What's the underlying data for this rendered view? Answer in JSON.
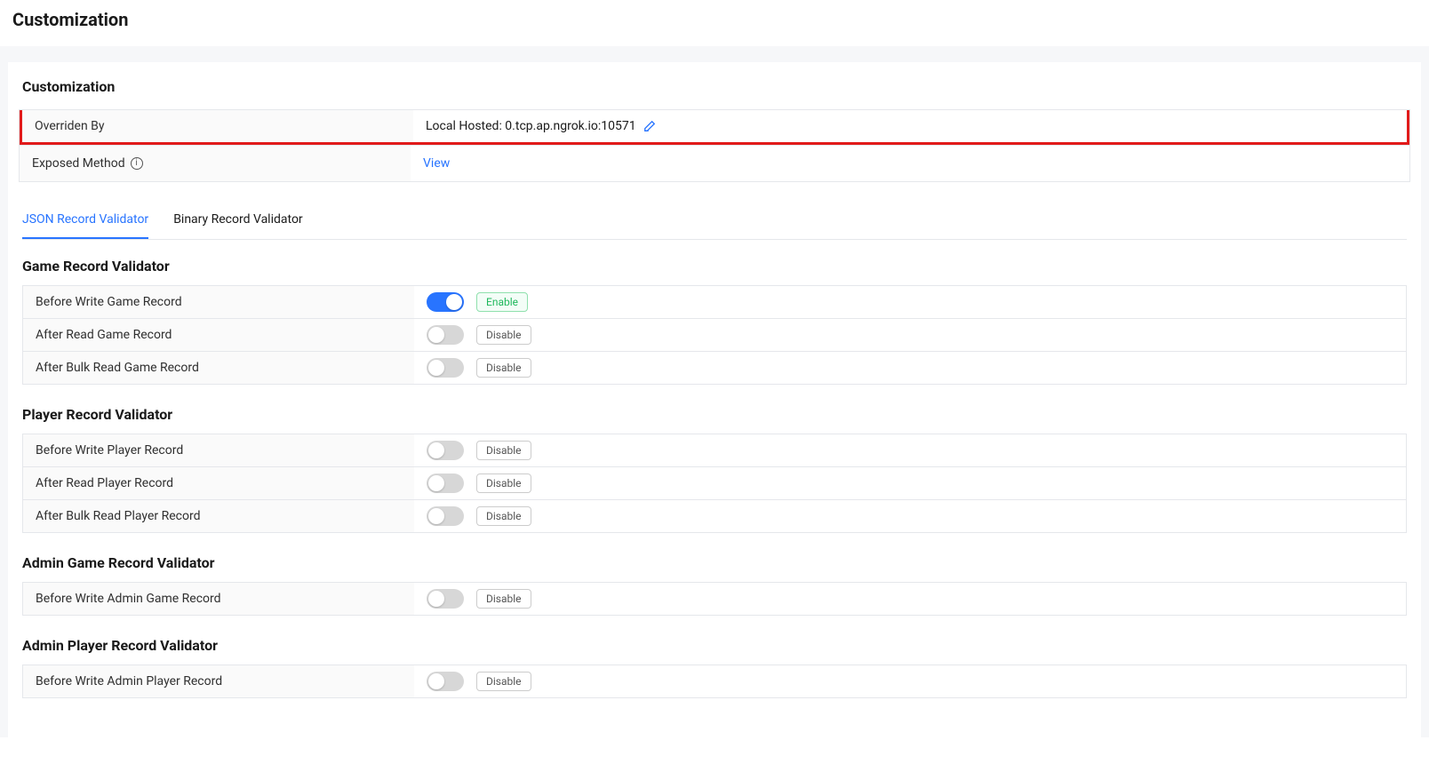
{
  "page": {
    "title": "Customization"
  },
  "card": {
    "title": "Customization",
    "overrideLabel": "Overriden By",
    "overrideValue": "Local Hosted: 0.tcp.ap.ngrok.io:10571",
    "exposedMethodLabel": "Exposed Method",
    "exposedMethodLink": "View"
  },
  "tabs": [
    {
      "label": "JSON Record Validator",
      "active": true
    },
    {
      "label": "Binary Record Validator",
      "active": false
    }
  ],
  "status": {
    "enable": "Enable",
    "disable": "Disable"
  },
  "sections": [
    {
      "title": "Game Record Validator",
      "rows": [
        {
          "label": "Before Write Game Record",
          "enabled": true
        },
        {
          "label": "After Read Game Record",
          "enabled": false
        },
        {
          "label": "After Bulk Read Game Record",
          "enabled": false
        }
      ]
    },
    {
      "title": "Player Record Validator",
      "rows": [
        {
          "label": "Before Write Player Record",
          "enabled": false
        },
        {
          "label": "After Read Player Record",
          "enabled": false
        },
        {
          "label": "After Bulk Read Player Record",
          "enabled": false
        }
      ]
    },
    {
      "title": "Admin Game Record Validator",
      "rows": [
        {
          "label": "Before Write Admin Game Record",
          "enabled": false
        }
      ]
    },
    {
      "title": "Admin Player Record Validator",
      "rows": [
        {
          "label": "Before Write Admin Player Record",
          "enabled": false
        }
      ]
    }
  ]
}
